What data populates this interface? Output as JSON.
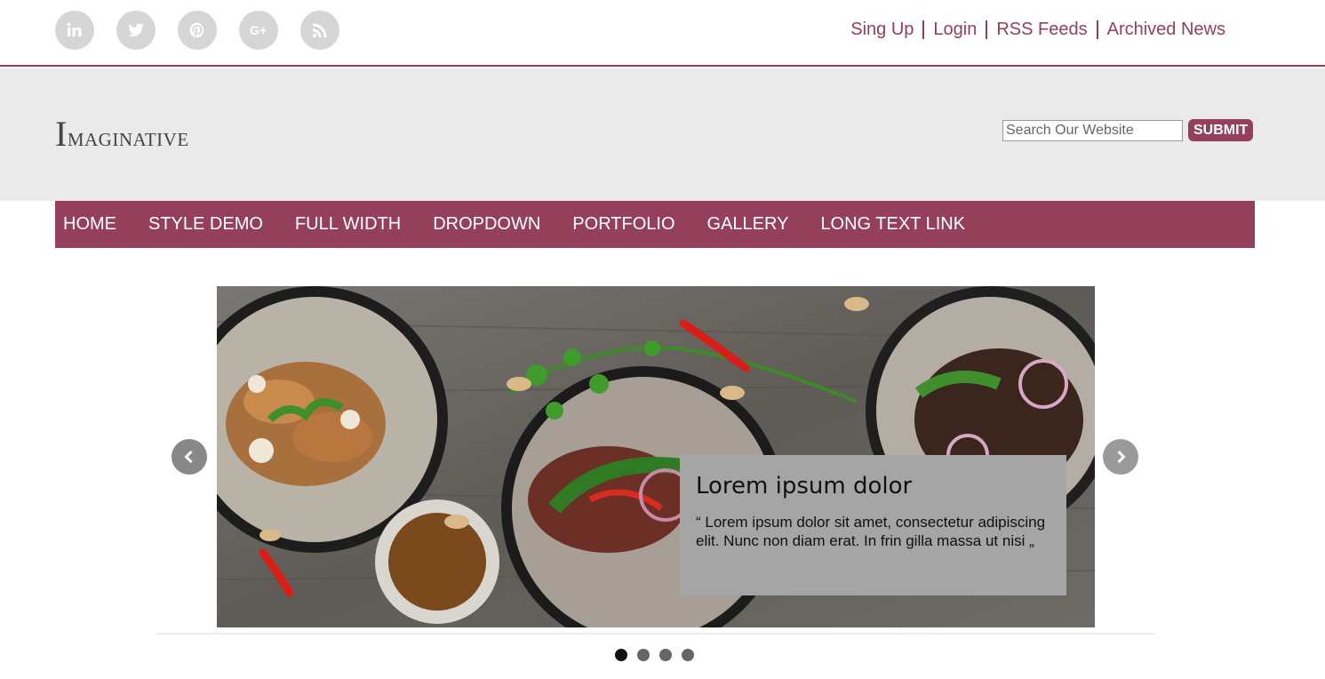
{
  "social": [
    {
      "name": "linkedin-icon",
      "label": "in"
    },
    {
      "name": "twitter-icon",
      "label": ""
    },
    {
      "name": "pinterest-icon",
      "label": ""
    },
    {
      "name": "google-plus-icon",
      "label": "G+"
    },
    {
      "name": "rss-icon",
      "label": ""
    }
  ],
  "top_links": [
    "Sing Up",
    "Login",
    "RSS Feeds",
    "Archived News"
  ],
  "logo": {
    "initial": "I",
    "rest": "maginative"
  },
  "search": {
    "placeholder": "Search Our Website",
    "submit_label": "SUBMIT"
  },
  "nav": [
    "HOME",
    "STYLE DEMO",
    "FULL WIDTH",
    "DROPDOWN",
    "PORTFOLIO",
    "GALLERY",
    "LONG TEXT LINK"
  ],
  "slider": {
    "caption_title": "Lorem ipsum dolor",
    "caption_text": "“ Lorem ipsum dolor sit amet, consectetur adipiscing elit. Nunc non diam erat. In frin gilla massa ut nisi „",
    "slide_count": 4,
    "active_slide": 1
  },
  "colors": {
    "accent": "#94405a",
    "header_bg": "#eaeaea",
    "social_bg": "#d6d6d6"
  }
}
